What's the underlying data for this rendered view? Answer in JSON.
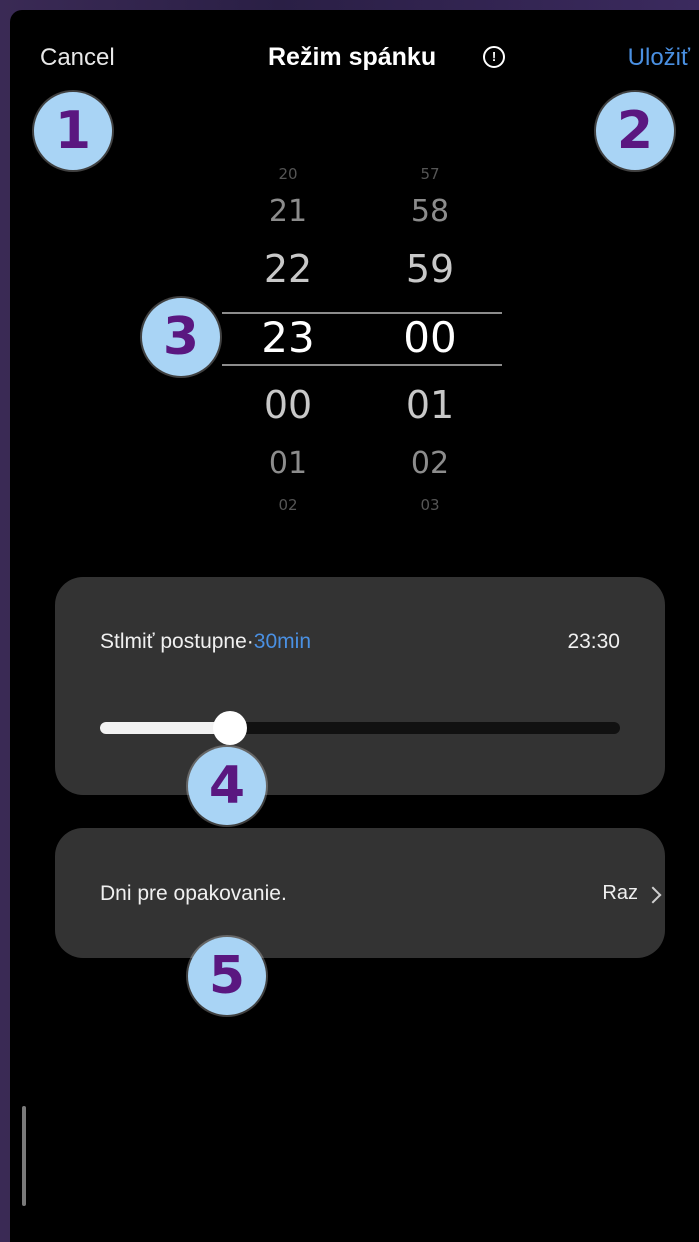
{
  "header": {
    "cancel_label": "Cancel",
    "title": "Režim spánku",
    "info_icon": "!",
    "save_label": "Uložiť"
  },
  "picker": {
    "hours": [
      "20",
      "21",
      "22",
      "23",
      "00",
      "01",
      "02"
    ],
    "minutes": [
      "57",
      "58",
      "59",
      "00",
      "01",
      "02",
      "03"
    ],
    "selected_hour": "23",
    "selected_minute": "00"
  },
  "fade": {
    "label": "Stlmiť postupne",
    "separator": "·",
    "duration": "30min",
    "end_time": "23:30",
    "slider_fraction": 0.25
  },
  "repeat": {
    "label": "Dni pre opakovanie.",
    "value": "Raz"
  },
  "badges": [
    "1",
    "2",
    "3",
    "4",
    "5"
  ],
  "colors": {
    "accent": "#4a90e2",
    "badge_bg": "#a9d4f5",
    "badge_text": "#5a1780",
    "card_bg": "#333333"
  }
}
